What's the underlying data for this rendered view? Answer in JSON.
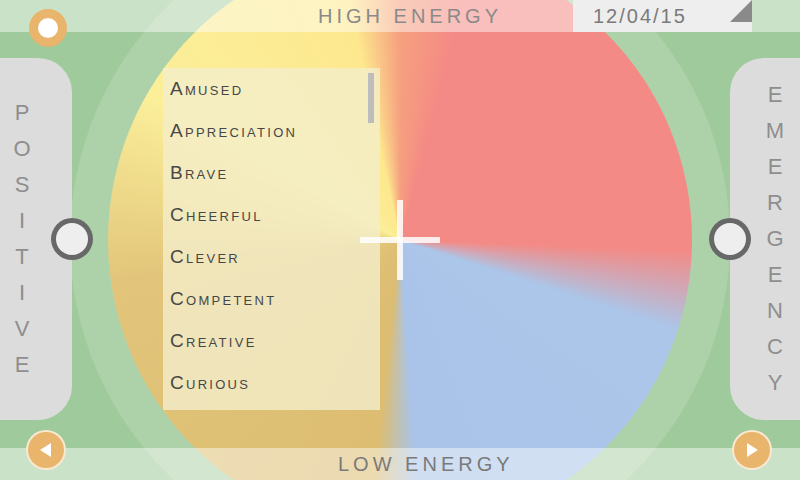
{
  "header": {
    "title": "HIGH ENERGY",
    "date": "12/04/15"
  },
  "footer": {
    "title": "LOW ENERGY"
  },
  "left_axis": {
    "label": "POSITIVE",
    "level": 0.5
  },
  "right_axis": {
    "label": "EMERGENCY",
    "level": 0.5
  },
  "emotions": {
    "items": [
      {
        "label": "Amused"
      },
      {
        "label": "Appreciation"
      },
      {
        "label": "Brave"
      },
      {
        "label": "Cheerful"
      },
      {
        "label": "Clever"
      },
      {
        "label": "Competent"
      },
      {
        "label": "Creative"
      },
      {
        "label": "Curious"
      }
    ],
    "scroll_level": 0
  }
}
